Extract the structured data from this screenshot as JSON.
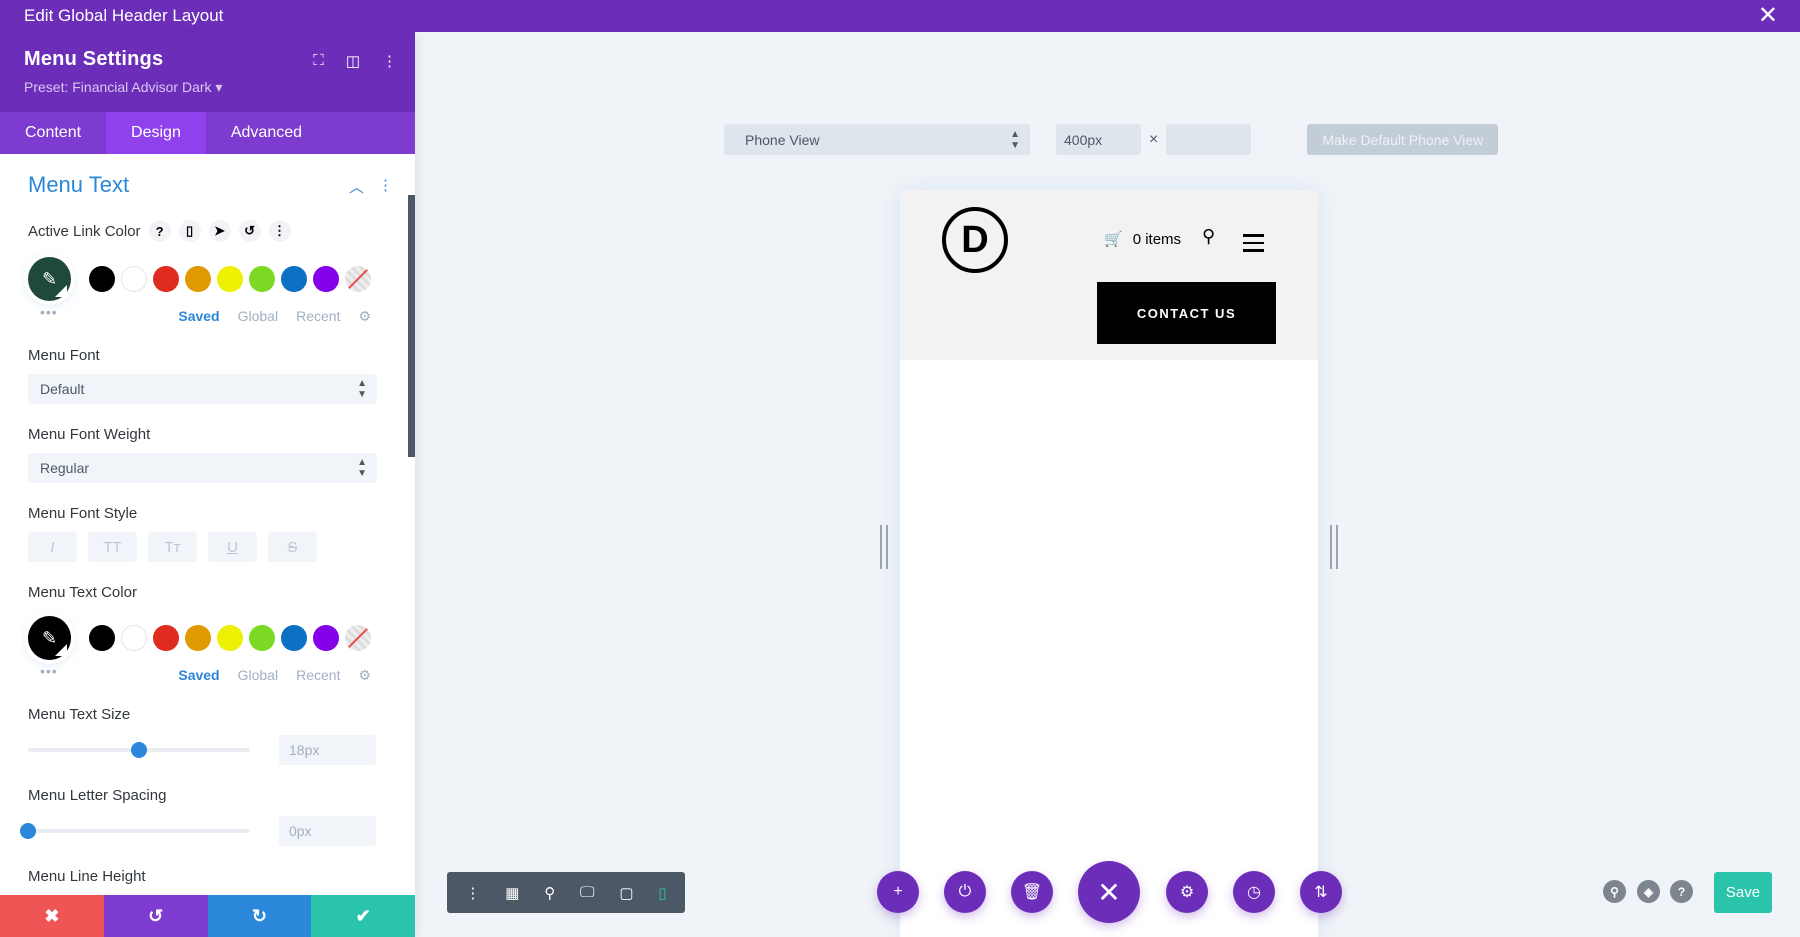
{
  "topbar": {
    "title": "Edit Global Header Layout",
    "close_icon": "close-icon"
  },
  "panel": {
    "title": "Menu Settings",
    "preset": "Preset: Financial Advisor Dark ▾",
    "tabs": [
      {
        "label": "Content"
      },
      {
        "label": "Design",
        "active": true
      },
      {
        "label": "Advanced"
      }
    ],
    "section_title": "Menu Text",
    "active_link_color": {
      "label": "Active Link Color",
      "current": "#1f4a3a",
      "swatches": [
        "#000000",
        "#ffffff",
        "#e02b20",
        "#e09900",
        "#edf000",
        "#7cda24",
        "#0c71c3",
        "#8300e9",
        "none"
      ],
      "swatch_tabs": [
        "Saved",
        "Global",
        "Recent"
      ],
      "active_swatch_tab": "Saved"
    },
    "menu_font": {
      "label": "Menu Font",
      "value": "Default"
    },
    "menu_font_weight": {
      "label": "Menu Font Weight",
      "value": "Regular"
    },
    "menu_font_style": {
      "label": "Menu Font Style",
      "options": [
        "I",
        "TT",
        "Tт",
        "U",
        "S"
      ]
    },
    "menu_text_color": {
      "label": "Menu Text Color",
      "current": "#000000",
      "swatches": [
        "#000000",
        "#ffffff",
        "#e02b20",
        "#e09900",
        "#edf000",
        "#7cda24",
        "#0c71c3",
        "#8300e9",
        "none"
      ],
      "swatch_tabs": [
        "Saved",
        "Global",
        "Recent"
      ],
      "active_swatch_tab": "Saved"
    },
    "menu_text_size": {
      "label": "Menu Text Size",
      "value": "18px",
      "slider_fraction": 0.5
    },
    "menu_letter_spacing": {
      "label": "Menu Letter Spacing",
      "value": "0px",
      "slider_fraction": 0.0
    },
    "menu_line_height": {
      "label": "Menu Line Height"
    },
    "footer": {
      "cancel": "✖",
      "undo": "↺",
      "redo": "↻",
      "confirm": "✔"
    }
  },
  "canvas": {
    "view_select": "Phone View",
    "width_value": "400px",
    "height_value": "",
    "times": "×",
    "make_default": "Make Default Phone View",
    "preview": {
      "logo_letter": "D",
      "cart_text": "0 items",
      "contact_button": "CONTACT US"
    }
  },
  "bottom_toolbar": {
    "icons": [
      "menu-icon",
      "wireframe-icon",
      "zoom-icon",
      "desktop-icon",
      "tablet-icon",
      "phone-icon"
    ]
  },
  "fabs": [
    "+",
    "⏻",
    "🗑",
    "✕",
    "⚙",
    "◷",
    "⇅"
  ],
  "right_tools": {
    "save": "Save",
    "icons": [
      "search-icon",
      "layers-icon",
      "help-icon"
    ]
  },
  "colors": {
    "brand_purple": "#6c2eb9",
    "accent_blue": "#2b87da",
    "save_green": "#29c4a9",
    "cancel_red": "#ef5555"
  }
}
